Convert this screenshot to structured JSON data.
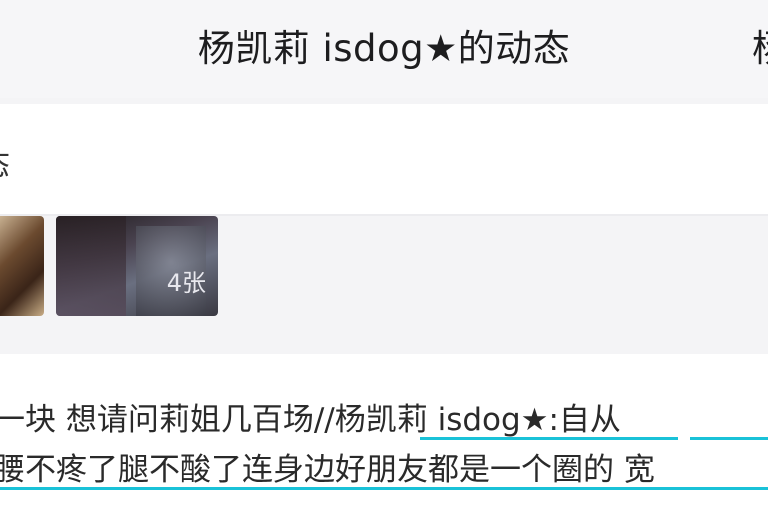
{
  "header": {
    "title": "杨凯莉 isdog★的动态",
    "title_cut": "杨"
  },
  "subrow": {
    "text": "态"
  },
  "photos": {
    "count_label": "4张"
  },
  "post": {
    "line1": "一块 想请问莉姐几百场//杨凯莉 isdog★:自从",
    "line2": "腰不疼了腿不酸了连身边好朋友都是一个圈的 宽"
  },
  "colors": {
    "underline": "#19c2d8",
    "background": "#f4f4f6"
  }
}
